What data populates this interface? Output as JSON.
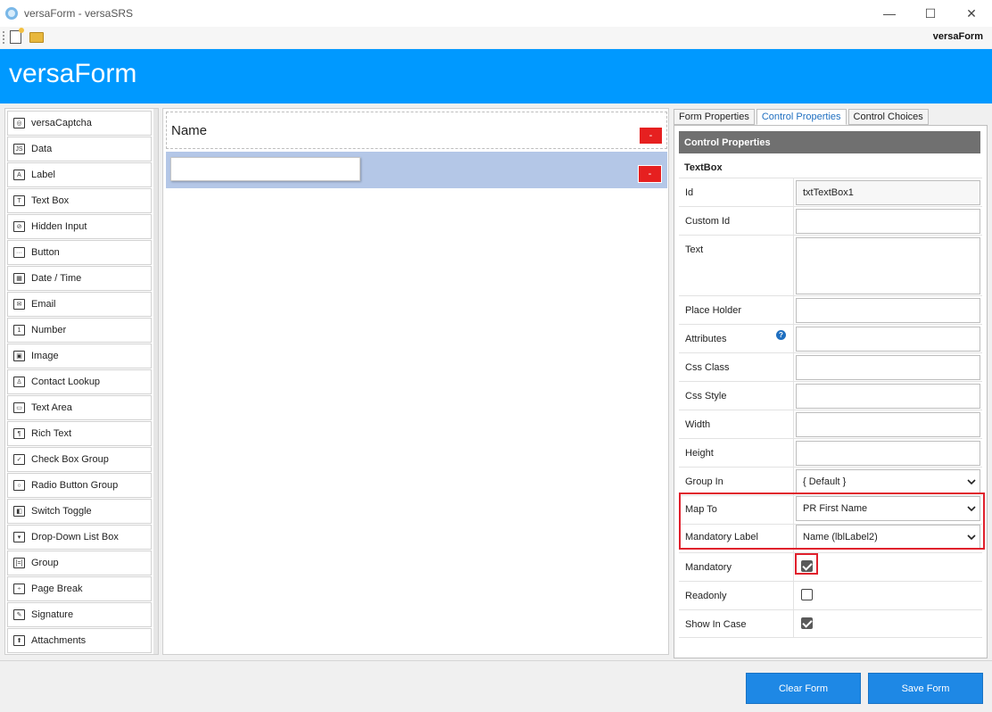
{
  "window": {
    "title": "versaForm - versaSRS",
    "minimize": "—",
    "maximize": "☐",
    "close": "✕"
  },
  "toolbar": {
    "brand": "versaForm"
  },
  "header": {
    "title": "versaForm",
    "color": "#0099ff"
  },
  "palette": {
    "items": [
      {
        "label": "versaCaptcha",
        "icon": "captcha-icon"
      },
      {
        "label": "Data",
        "icon": "json-icon"
      },
      {
        "label": "Label",
        "icon": "label-icon"
      },
      {
        "label": "Text Box",
        "icon": "textbox-icon"
      },
      {
        "label": "Hidden Input",
        "icon": "hidden-input-icon"
      },
      {
        "label": "Button",
        "icon": "button-icon"
      },
      {
        "label": "Date / Time",
        "icon": "calendar-icon"
      },
      {
        "label": "Email",
        "icon": "envelope-icon"
      },
      {
        "label": "Number",
        "icon": "number-icon"
      },
      {
        "label": "Image",
        "icon": "image-icon"
      },
      {
        "label": "Contact Lookup",
        "icon": "contact-icon"
      },
      {
        "label": "Text Area",
        "icon": "textarea-icon"
      },
      {
        "label": "Rich Text",
        "icon": "rich-text-icon"
      },
      {
        "label": "Check Box Group",
        "icon": "checkbox-icon"
      },
      {
        "label": "Radio Button Group",
        "icon": "radio-icon"
      },
      {
        "label": "Switch Toggle",
        "icon": "toggle-icon"
      },
      {
        "label": "Drop-Down List Box",
        "icon": "dropdown-icon"
      },
      {
        "label": "Group",
        "icon": "group-icon"
      },
      {
        "label": "Page Break",
        "icon": "page-break-icon"
      },
      {
        "label": "Signature",
        "icon": "signature-icon"
      },
      {
        "label": "Attachments",
        "icon": "upload-icon"
      }
    ]
  },
  "canvas": {
    "row1_label": "Name",
    "delete_label": "-",
    "selected_color": "#b4c7e7"
  },
  "tabs": {
    "form_properties": "Form Properties",
    "control_properties": "Control Properties",
    "control_choices": "Control Choices"
  },
  "props": {
    "header": "Control Properties",
    "type": "TextBox",
    "id_label": "Id",
    "id_value": "txtTextBox1",
    "custom_id_label": "Custom Id",
    "text_label": "Text",
    "place_holder_label": "Place Holder",
    "attributes_label": "Attributes",
    "help": "?",
    "css_class_label": "Css Class",
    "css_style_label": "Css Style",
    "width_label": "Width",
    "height_label": "Height",
    "group_in_label": "Group In",
    "group_in_value": "{ Default }",
    "map_to_label": "Map To",
    "map_to_value": "PR First Name",
    "mandatory_label_label": "Mandatory Label",
    "mandatory_label_value": "Name (lblLabel2)",
    "mandatory_label": "Mandatory",
    "mandatory_checked": true,
    "readonly_label": "Readonly",
    "readonly_checked": false,
    "show_in_case_label": "Show In Case",
    "show_in_case_checked": true
  },
  "actions": {
    "clear": "Clear Form",
    "save": "Save Form",
    "color": "#1e88e5"
  }
}
